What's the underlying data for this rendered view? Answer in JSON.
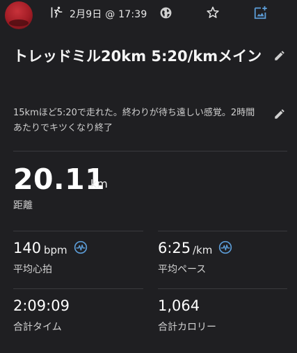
{
  "header": {
    "date": "2月9日 @ 17:39",
    "icons": {
      "activity": "running-icon",
      "visibility": "globe-icon",
      "favorite": "star-icon",
      "add_photo": "add-photo-icon"
    }
  },
  "activity": {
    "title": "トレッドミル20km 5:20/kmメイン",
    "description": "15kmほど5:20で走れた。終わりが待ち遠しい感覚。2時間あたりでキツくなり終了"
  },
  "distance": {
    "value": "20.11",
    "unit": "km",
    "label": "距離"
  },
  "stats": {
    "heart_rate": {
      "value": "140",
      "unit": "bpm",
      "label": "平均心拍",
      "icon": "pulse-icon"
    },
    "pace": {
      "value": "6:25",
      "unit": "/km",
      "label": "平均ペース",
      "icon": "pulse-icon"
    },
    "time": {
      "value": "2:09:09",
      "label": "合計タイム"
    },
    "calories": {
      "value": "1,064",
      "label": "合計カロリー"
    }
  },
  "colors": {
    "background": "#1f1f22",
    "accent_blue": "#5b9bd5",
    "divider": "#3a3a3e"
  }
}
